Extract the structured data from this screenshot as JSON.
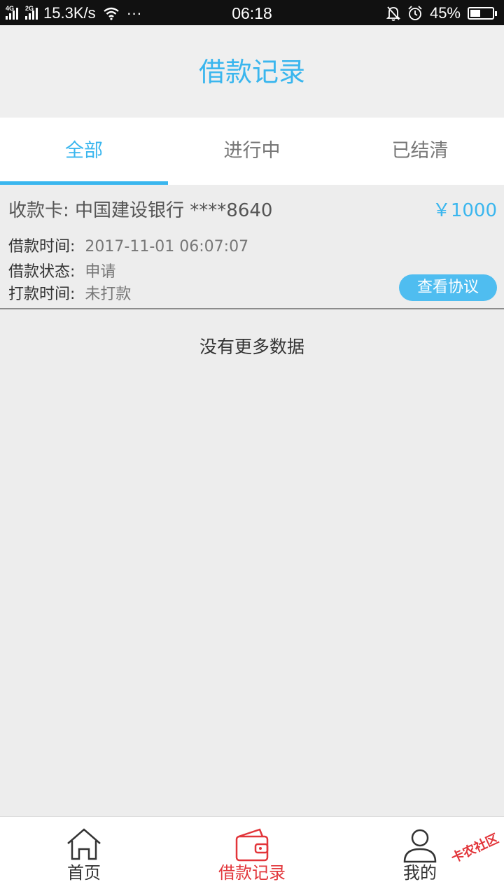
{
  "status_bar": {
    "net1": "4G",
    "net2": "2G",
    "speed": "15.3K/s",
    "dots": "···",
    "time": "06:18",
    "battery": "45%",
    "battery_level": 0.45
  },
  "header": {
    "title": "借款记录"
  },
  "tabs": [
    {
      "label": "全部",
      "active": true
    },
    {
      "label": "进行中",
      "active": false
    },
    {
      "label": "已结清",
      "active": false
    }
  ],
  "record": {
    "card_label": "收款卡: 中国建设银行 ****8640",
    "amount": "￥1000",
    "loan_time_label": "借款时间:",
    "loan_time": "2017-11-01 06:07:07",
    "status_label": "借款状态:",
    "status": "申请",
    "payout_label": "打款时间:",
    "payout": "未打款",
    "agreement_button": "查看协议"
  },
  "no_more": "没有更多数据",
  "bottom_nav": [
    {
      "label": "首页",
      "icon": "home-icon",
      "active": false
    },
    {
      "label": "借款记录",
      "icon": "wallet-icon",
      "active": true
    },
    {
      "label": "我的",
      "icon": "user-icon",
      "active": false
    }
  ],
  "watermark": "卡农社区",
  "colors": {
    "accent": "#3ab6ee",
    "nav_active": "#e2353a"
  }
}
